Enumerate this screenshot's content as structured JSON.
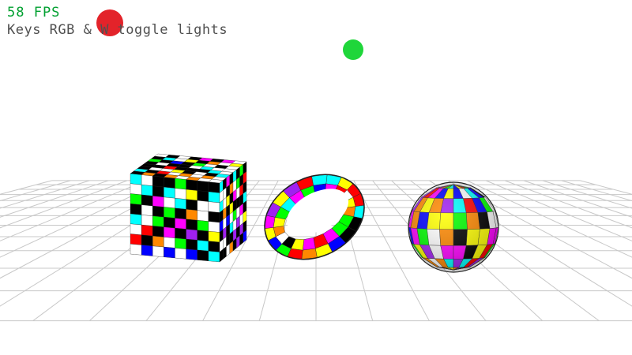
{
  "hud": {
    "fps_text": "58 FPS",
    "help_text": "Keys RGB & W toggle lights"
  },
  "scene": {
    "background": "#ffffff",
    "grid_color": "#c8c8c8",
    "objects": [
      {
        "name": "cube",
        "shape": "cube",
        "texture": "checker-glyph-texture"
      },
      {
        "name": "torus",
        "shape": "torus",
        "texture": "checker-glyph-texture"
      },
      {
        "name": "sphere",
        "shape": "sphere",
        "texture": "checker-glyph-texture"
      }
    ],
    "lights": [
      {
        "name": "red-light",
        "color": "#e3232a"
      },
      {
        "name": "green-light",
        "color": "#1fd63a"
      }
    ],
    "texture_palette": [
      "#ff0000",
      "#00ff00",
      "#0000ff",
      "#ffff00",
      "#00ffff",
      "#ff00ff",
      "#000000",
      "#ffffff",
      "#a020f0",
      "#ff8800"
    ]
  }
}
